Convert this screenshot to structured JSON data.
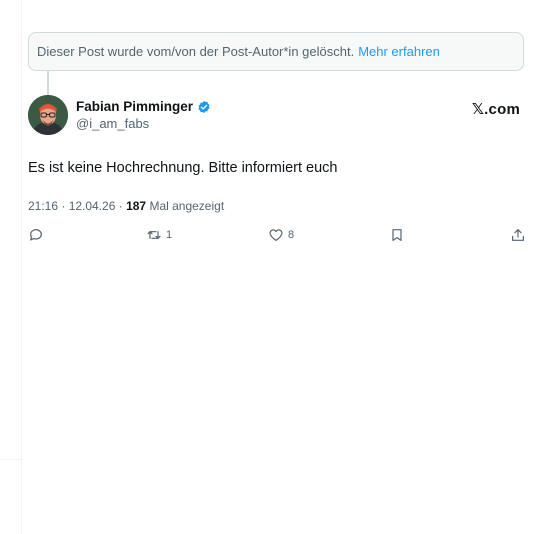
{
  "deleted_notice": {
    "text": "Dieser Post wurde vom/von der Post-Autor*in gelöscht.",
    "link": "Mehr erfahren"
  },
  "post": {
    "author_name": "Fabian Pimminger",
    "handle": "@i_am_fabs",
    "source": "𝕏.com",
    "text": "Es ist keine Hochrechnung. Bitte informiert euch",
    "time": "21:16 · 12.04.26 · ",
    "views": "187",
    "views_label": " Mal angezeigt"
  },
  "actions": {
    "reply_count": "",
    "repost_count": "1",
    "like_count": "8"
  },
  "icons": [
    "verified-badge-icon",
    "reply-icon",
    "repost-icon",
    "like-icon",
    "bookmark-icon",
    "share-icon"
  ],
  "colors": {
    "accent": "#1d9bf0",
    "text": "#0f1419",
    "muted": "#536471",
    "border": "#cfd9de"
  }
}
